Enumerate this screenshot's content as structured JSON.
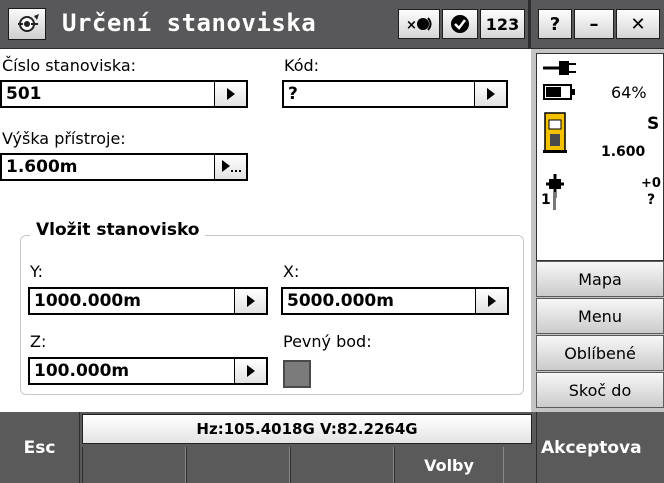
{
  "window": {
    "title": "Určení stanoviska",
    "app_icon": "instrument-icon",
    "title_buttons": {
      "wireless_icon": "wireless-icon",
      "check_icon": "check-icon",
      "input_mode": "123",
      "help": "?",
      "minimize": "–",
      "close": "✕"
    }
  },
  "form": {
    "station_label": "Číslo stanoviska:",
    "station_value": "501",
    "code_label": "Kód:",
    "code_value": "?",
    "height_label": "Výška přístroje:",
    "height_value": "1.600m",
    "group_title": "Vložit stanovisko",
    "y_label": "Y:",
    "y_value": "1000.000m",
    "x_label": "X:",
    "x_value": "5000.000m",
    "z_label": "Z:",
    "z_value": "100.000m",
    "fixed_point_label": "Pevný bod:",
    "fixed_point_checked": false
  },
  "status_panel": {
    "battery_percent": "64%",
    "battery_level": 0.64,
    "instrument_code": "S",
    "instrument_height": "1.600",
    "target_offset": "+0",
    "target_number": "1",
    "target_value": "?"
  },
  "side_buttons": {
    "map": "Mapa",
    "menu": "Menu",
    "favorites": "Oblíbené",
    "goto": "Skoč do"
  },
  "bottom": {
    "esc": "Esc",
    "angles": "Hz:105.4018G  V:82.2264G",
    "options": "Volby",
    "accept": "Akceptova"
  },
  "colors": {
    "title_bar": "#58585a",
    "panel_gray": "#c4c4c4",
    "accent_yellow": "#f2c200"
  }
}
